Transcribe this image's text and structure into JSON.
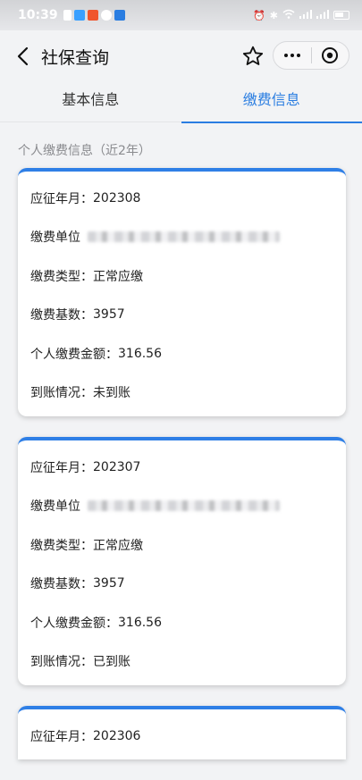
{
  "status_bar": {
    "time": "10:39"
  },
  "nav": {
    "title": "社保查询"
  },
  "tabs": [
    {
      "label": "基本信息",
      "active": false
    },
    {
      "label": "缴费信息",
      "active": true
    }
  ],
  "section_label": "个人缴费信息（近2年）",
  "labels": {
    "period": "应征年月：",
    "unit": "缴费单位",
    "type": "缴费类型：",
    "base": "缴费基数：",
    "amount": "个人缴费金额：",
    "status": "到账情况："
  },
  "records": [
    {
      "period": "202308",
      "type": "正常应缴",
      "base": "3957",
      "amount": "316.56",
      "status": "未到账"
    },
    {
      "period": "202307",
      "type": "正常应缴",
      "base": "3957",
      "amount": "316.56",
      "status": "已到账"
    },
    {
      "period": "202306"
    }
  ],
  "colors": {
    "accent": "#2a7de1",
    "card_top": "#2f7fe6"
  },
  "icons": [
    "back-arrow-icon",
    "star-icon",
    "more-icon",
    "close-circle-icon",
    "wifi-icon",
    "battery-icon"
  ]
}
